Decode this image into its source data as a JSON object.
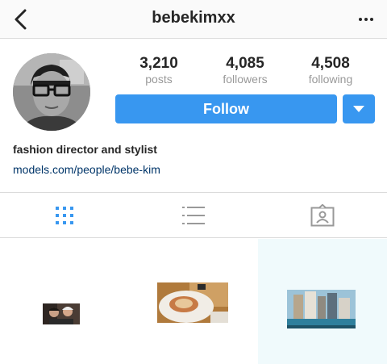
{
  "header": {
    "username": "bebekimxx",
    "back_icon": "chevron-left-icon",
    "more_icon": "more-horizontal-icon"
  },
  "profile": {
    "avatar_icon": "profile-avatar",
    "stats": [
      {
        "value": "3,210",
        "label": "posts"
      },
      {
        "value": "4,085",
        "label": "followers"
      },
      {
        "value": "4,508",
        "label": "following"
      }
    ],
    "follow_label": "Follow",
    "dropdown_icon": "caret-down-icon",
    "bio": "fashion director and stylist",
    "link": "models.com/people/bebe-kim"
  },
  "tabs": [
    {
      "name": "grid",
      "icon": "grid-icon",
      "active": true
    },
    {
      "name": "list",
      "icon": "list-icon",
      "active": false
    },
    {
      "name": "tagged",
      "icon": "tagged-icon",
      "active": false
    }
  ],
  "colors": {
    "accent": "#3897f0",
    "link": "#003569",
    "muted": "#999999",
    "text": "#262626"
  },
  "posts": [
    {
      "subject": "two people selfie"
    },
    {
      "subject": "food in white bowl"
    },
    {
      "subject": "city buildings with pool"
    }
  ]
}
